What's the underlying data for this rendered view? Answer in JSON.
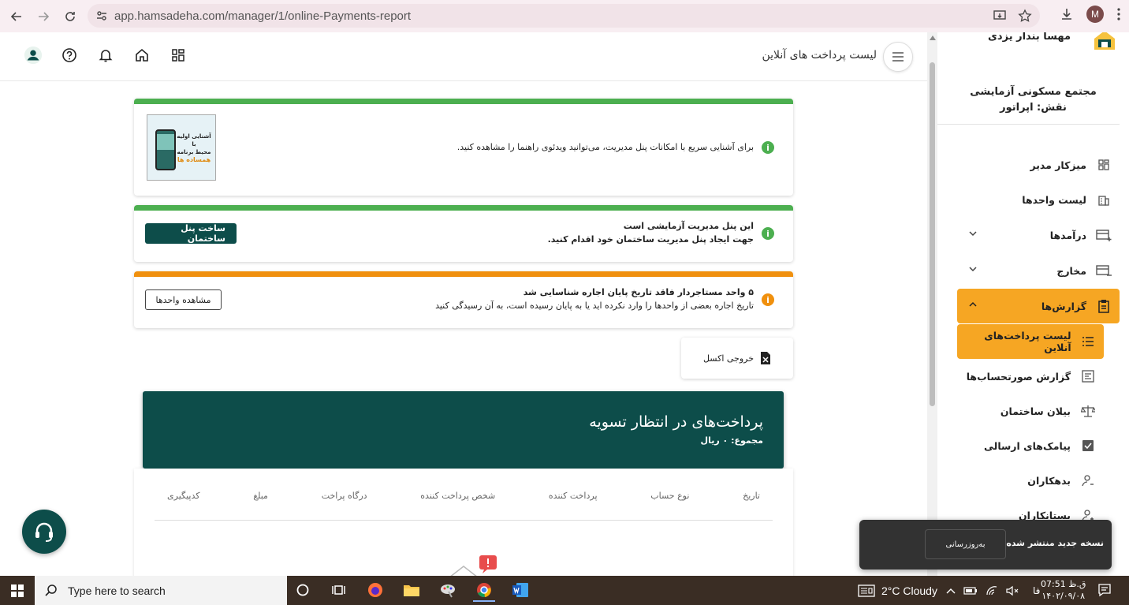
{
  "browser": {
    "url": "app.hamsadeha.com/manager/1/online-Payments-report",
    "profile_initial": "M"
  },
  "header": {
    "title": "لیست پرداخت های آنلاین"
  },
  "intro_card": {
    "text": "برای آشنایی سریع با امکانات پنل مدیریت، می‌توانید ویدئوی راهنما را مشاهده کنید.",
    "thumb_line1": "آشنایی اولیه با",
    "thumb_line2": "محیط برنامه",
    "thumb_brand": "همساده ها"
  },
  "demo_card": {
    "title": "این پنل مدیریت آزمایشی است",
    "text": "جهت ایجاد پنل مدیریت ساختمان خود اقدام کنید.",
    "button": "ساخت پنل ساختمان"
  },
  "lease_card": {
    "title": "۵ واحد مستاجردار فاقد تاریخ پایان اجاره شناسایی شد",
    "text": "تاریخ اجاره بعضی از واحدها را وارد نکرده اید یا به پایان رسیده است، به آن رسیدگی کنید",
    "button": "مشاهده واحدها"
  },
  "excel": {
    "label": "خروجی اکسل"
  },
  "pending": {
    "title": "پرداخت‌های در انتظار تسویه",
    "total": "مجموع: ۰ ریال"
  },
  "table": {
    "columns": [
      "تاریخ",
      "نوع حساب",
      "پرداخت کننده",
      "شخص پرداخت کننده",
      "درگاه پراخت",
      "مبلغ",
      "کدپیگیری"
    ]
  },
  "sidebar": {
    "user_name": "مهسا بندار یزدی",
    "complex_name": "مجتمع مسکونی آزمایشی",
    "role": "نقش: اپراتور",
    "items": [
      {
        "label": "میزکار مدیر",
        "icon": "dashboard-icon"
      },
      {
        "label": "لیست واحدها",
        "icon": "building-icon"
      },
      {
        "label": "درآمدها",
        "icon": "card-plus-icon"
      },
      {
        "label": "مخارج",
        "icon": "card-minus-icon"
      },
      {
        "label": "گزارش‌ها",
        "icon": "clipboard-icon"
      }
    ],
    "sub_items": [
      {
        "label": "لیست پرداخت‌های آنلاین",
        "icon": "list-icon"
      },
      {
        "label": "گزارش صورتحساب‌ها",
        "icon": "invoice-icon"
      },
      {
        "label": "بیلان ساختمان",
        "icon": "scale-icon"
      },
      {
        "label": "پیامک‌های ارسالی",
        "icon": "sms-icon"
      },
      {
        "label": "بدهکاران",
        "icon": "debtor-icon"
      },
      {
        "label": "بستانکاران",
        "icon": "creditor-icon"
      }
    ]
  },
  "toast": {
    "text": "نسخه جدید منتشر شده است.",
    "button": "بەروزرسانی"
  },
  "taskbar": {
    "search_placeholder": "Type here to search",
    "weather": "2°C  Cloudy",
    "lang": "فا",
    "time": "ق.ظ 07:51",
    "date": "۱۴۰۲/۰۹/۰۸"
  }
}
